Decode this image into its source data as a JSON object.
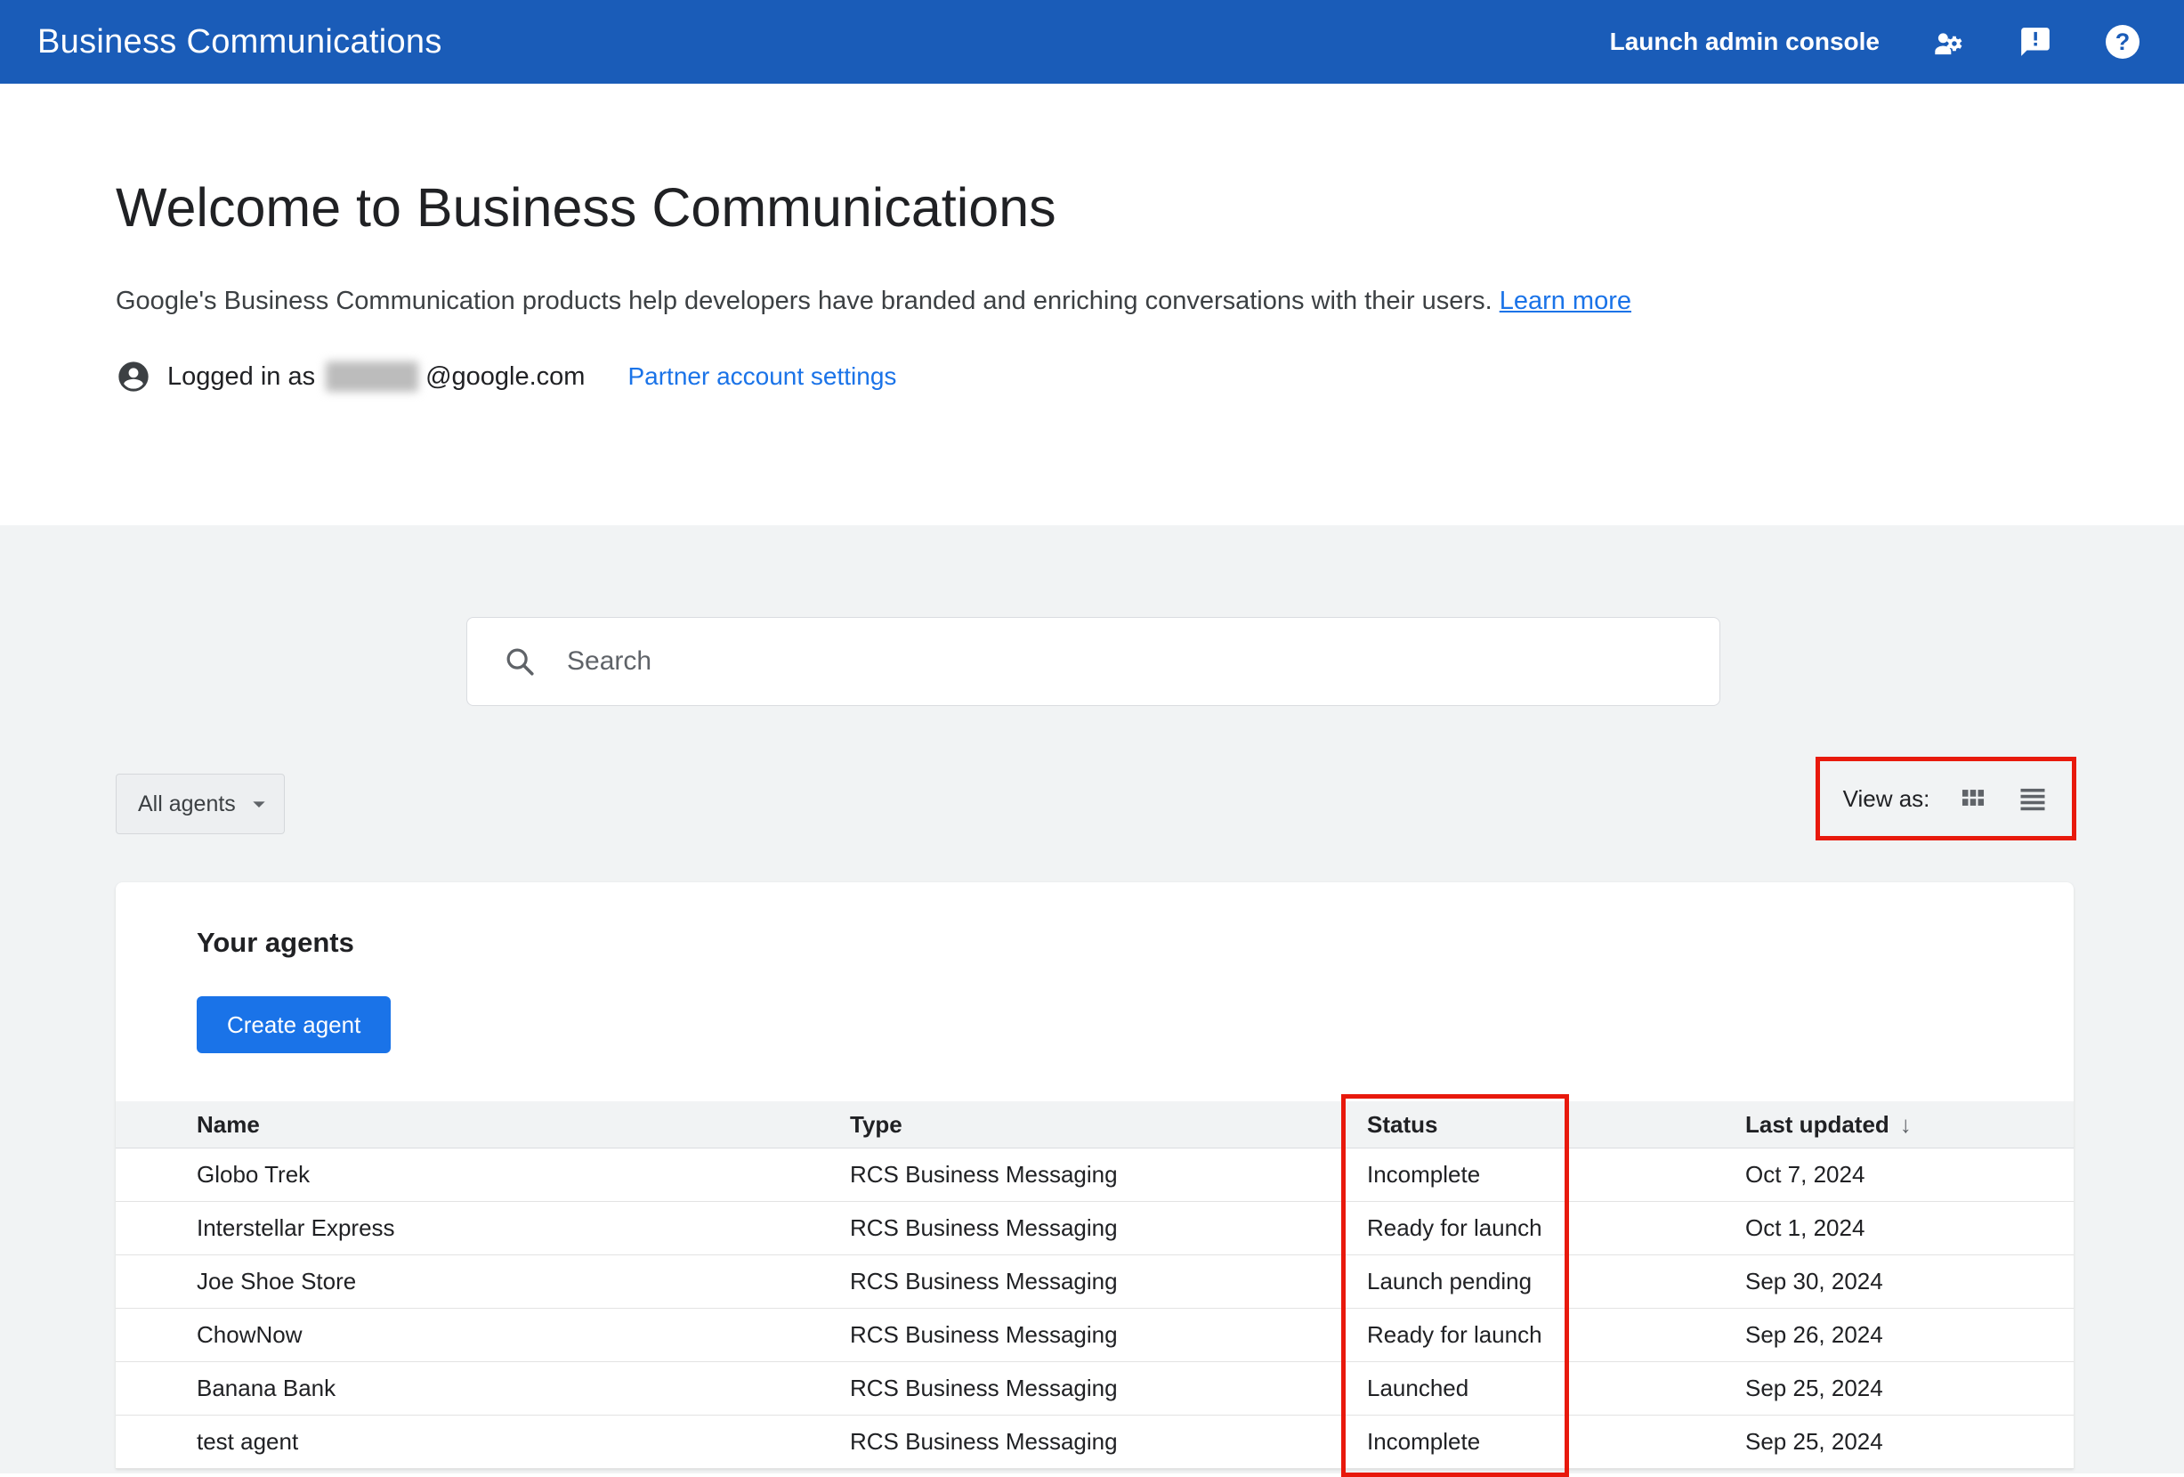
{
  "header": {
    "title": "Business Communications",
    "launch_admin_label": "Launch admin console",
    "icons": {
      "admin": "manage-accounts-icon",
      "feedback": "feedback-icon",
      "help": "help-icon"
    }
  },
  "welcome": {
    "title": "Welcome to Business Communications",
    "subtitle": "Google's Business Communication products help developers have branded and enriching conversations with their users.",
    "learn_more_label": "Learn more",
    "logged_in_prefix": "Logged in as",
    "email_domain": "@google.com",
    "partner_settings_label": "Partner account settings"
  },
  "toolbar": {
    "search_placeholder": "Search",
    "filter_label": "All agents",
    "view_as_label": "View as:",
    "view_icons": [
      "grid-view-icon",
      "list-view-icon"
    ]
  },
  "agents": {
    "section_title": "Your agents",
    "create_button_label": "Create agent",
    "columns": [
      "Name",
      "Type",
      "Status",
      "Last updated"
    ],
    "sort_arrow": "↓",
    "rows": [
      {
        "name": "Globo Trek",
        "type": "RCS Business Messaging",
        "status": "Incomplete",
        "updated": "Oct 7, 2024"
      },
      {
        "name": "Interstellar Express",
        "type": "RCS Business Messaging",
        "status": "Ready for launch",
        "updated": "Oct 1, 2024"
      },
      {
        "name": "Joe Shoe Store",
        "type": "RCS Business Messaging",
        "status": "Launch pending",
        "updated": "Sep 30, 2024"
      },
      {
        "name": "ChowNow",
        "type": "RCS Business Messaging",
        "status": "Ready for launch",
        "updated": "Sep 26, 2024"
      },
      {
        "name": "Banana Bank",
        "type": "RCS Business Messaging",
        "status": "Launched",
        "updated": "Sep 25, 2024"
      },
      {
        "name": "test agent",
        "type": "RCS Business Messaging",
        "status": "Incomplete",
        "updated": "Sep 25, 2024"
      }
    ]
  },
  "colors": {
    "appbar_blue": "#1a5cb8",
    "accent_blue": "#1a73e8",
    "annotation_red": "#e8190c",
    "section_gray": "#f1f3f4"
  }
}
